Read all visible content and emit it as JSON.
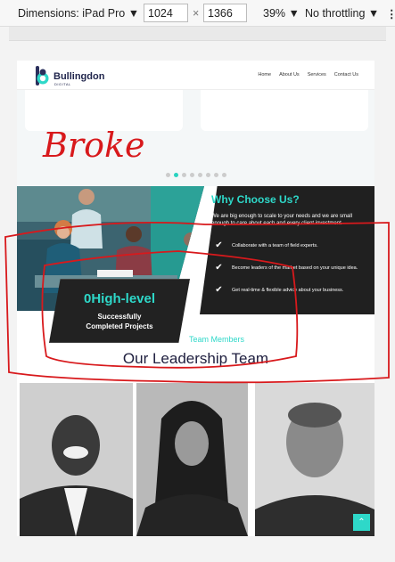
{
  "devtools": {
    "dimensions_label": "Dimensions: iPad Pro",
    "width": "1024",
    "times": "×",
    "height": "1366",
    "zoom": "39%",
    "throttling": "No throttling",
    "caret": "▼",
    "more": "⋮"
  },
  "site": {
    "brand": "Bullingdon",
    "brand_sub": "DIGITAL",
    "nav": [
      "Home",
      "About Us",
      "Services",
      "Contact Us"
    ]
  },
  "carousel": {
    "dots": 8,
    "active": 1
  },
  "why": {
    "title": "Why Choose Us?",
    "intro": "We are big enough to scale to your needs and we are small enough to care about each and every client investment",
    "features": [
      "Collaborate with a team of field experts.",
      "Become leaders of the market based on your unique idea.",
      "Get real-time & flexible advice about your business."
    ]
  },
  "stat": {
    "number": "0",
    "suffix": "High-level",
    "line1": "Successfully",
    "line2": "Completed Projects"
  },
  "team": {
    "kicker": "Team Members",
    "title": "Our Leadership Team"
  },
  "annotation": {
    "text": "Broke",
    "color": "#d8191c"
  },
  "colors": {
    "accent": "#2ed8c9",
    "dark": "#202020",
    "annotation": "#d8191c"
  },
  "icons": {
    "check": "✔",
    "to_top": "⌃"
  }
}
